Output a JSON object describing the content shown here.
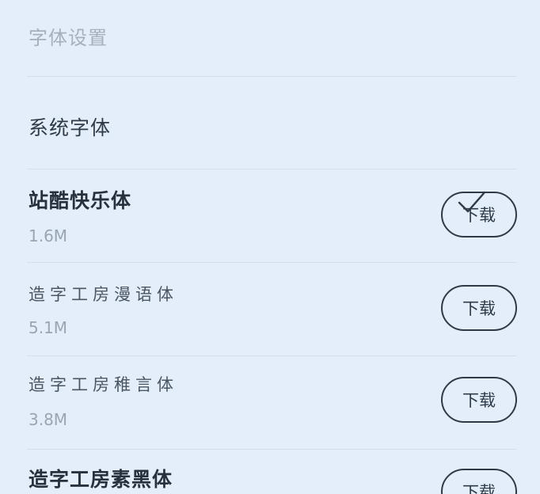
{
  "header": {
    "title": "字体设置"
  },
  "system_font": {
    "label": "系统字体",
    "selected": true,
    "check_icon": "checkmark-icon"
  },
  "fonts": [
    {
      "name": "站酷快乐体",
      "size": "1.6M",
      "action": "下载"
    },
    {
      "name": "造字工房漫语体",
      "size": "5.1M",
      "action": "下载"
    },
    {
      "name": "造字工房稚言体",
      "size": "3.8M",
      "action": "下载"
    },
    {
      "name": "造字工房素黑体",
      "size": "",
      "action": "下载"
    }
  ]
}
